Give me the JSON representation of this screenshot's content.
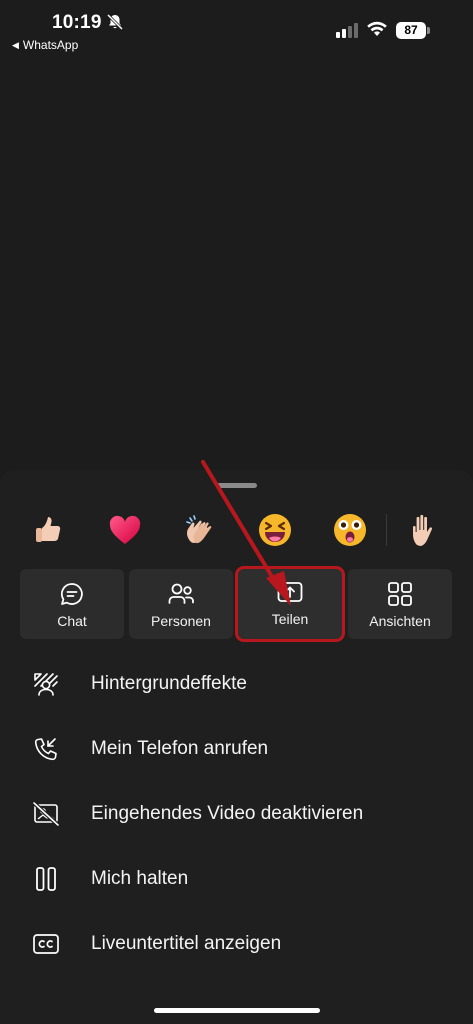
{
  "status": {
    "time": "10:19",
    "back_app": "WhatsApp",
    "battery": "87"
  },
  "reactions": [
    {
      "name": "thumbs-up",
      "glyph": "👍"
    },
    {
      "name": "heart",
      "glyph": "❤️"
    },
    {
      "name": "applause",
      "glyph": "👏"
    },
    {
      "name": "laugh",
      "glyph": "😆"
    },
    {
      "name": "surprised",
      "glyph": "😮"
    },
    {
      "name": "raise-hand",
      "glyph": "✋"
    }
  ],
  "tiles": [
    {
      "label": "Chat",
      "icon": "chat-icon"
    },
    {
      "label": "Personen",
      "icon": "people-icon"
    },
    {
      "label": "Teilen",
      "icon": "share-icon"
    },
    {
      "label": "Ansichten",
      "icon": "views-icon"
    }
  ],
  "menu": [
    {
      "label": "Hintergrundeffekte",
      "icon": "background-effects-icon"
    },
    {
      "label": "Mein Telefon anrufen",
      "icon": "call-phone-icon"
    },
    {
      "label": "Eingehendes Video deaktivieren",
      "icon": "video-off-icon"
    },
    {
      "label": "Mich halten",
      "icon": "hold-icon"
    },
    {
      "label": "Liveuntertitel anzeigen",
      "icon": "captions-icon"
    }
  ],
  "colors": {
    "background": "#1c1c1c",
    "sheet": "#1f1f1f",
    "tile": "#2c2c2c",
    "annotation": "#b8181d"
  }
}
